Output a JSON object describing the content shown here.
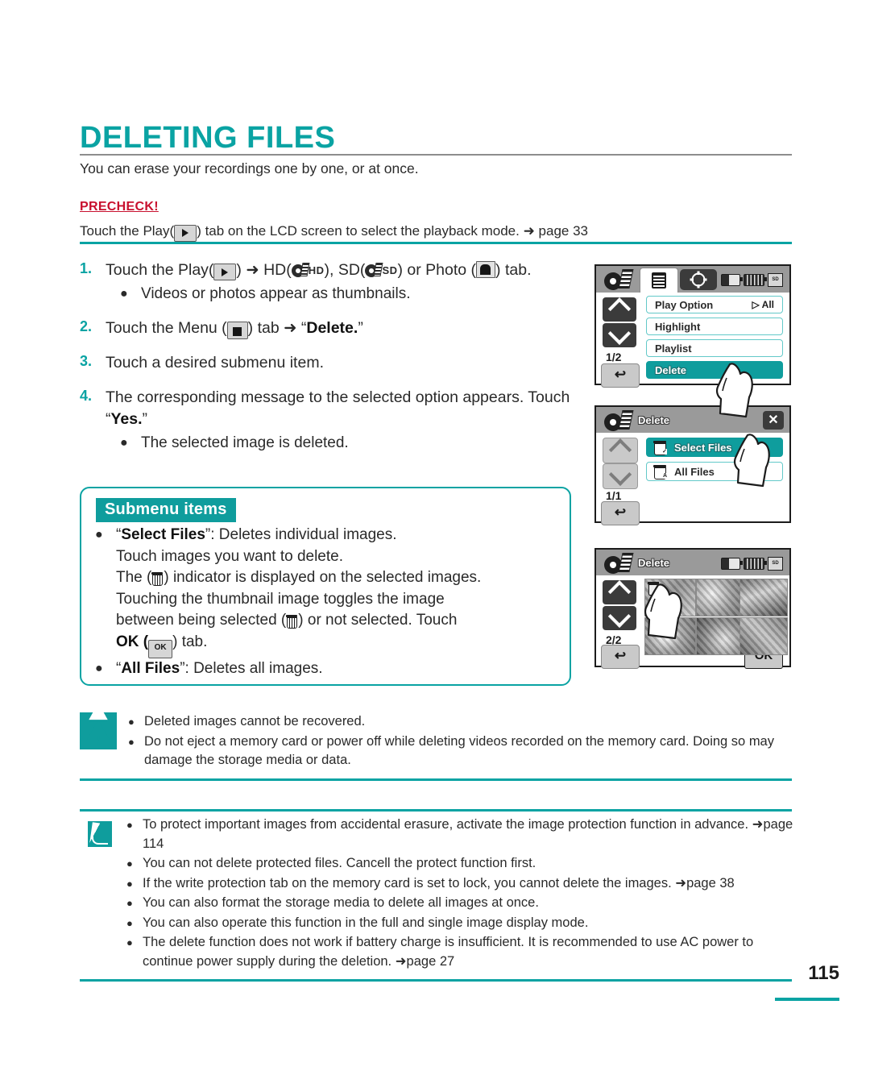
{
  "page": {
    "title": "DELETING FILES",
    "intro": "You can erase your recordings one by one, or at once.",
    "precheck_label": "PRECHECK!",
    "precheck_text_a": "Touch the Play(",
    "precheck_text_b": ") tab on the LCD screen to select the playback mode. ",
    "precheck_page_ref": "➜ page 33",
    "page_number": "115"
  },
  "steps": [
    {
      "num": "1.",
      "text_a": "Touch the Play(",
      "text_b": ") ➜ HD(",
      "hd_label": "HD",
      "text_c": "), SD(",
      "sd_label": "SD",
      "text_d": ") or Photo (",
      "text_e": ") tab.",
      "bullets": [
        "Videos or photos appear as thumbnails."
      ]
    },
    {
      "num": "2.",
      "text_a": "Touch the Menu (",
      "text_b": ") tab ➜ “",
      "bold": "Delete.",
      "text_c": "”",
      "bullets": []
    },
    {
      "num": "3.",
      "text_a": "Touch a desired submenu item.",
      "bullets": []
    },
    {
      "num": "4.",
      "text_a": "The corresponding message to the selected option appears. Touch “",
      "bold": "Yes.",
      "text_c": "”",
      "bullets": [
        "The selected image is deleted."
      ]
    }
  ],
  "submenu": {
    "title": "Submenu items",
    "items": [
      {
        "name": "Select Files",
        "quote_open": "“",
        "quote_close": "”",
        "line1_tail": ": Deletes individual images.",
        "line2": "Touch images you want to delete.",
        "line3_a": "The (",
        "line3_b": ") indicator is displayed on the selected images.",
        "line4": "Touching the thumbnail image toggles the image",
        "line5_a": "between being selected (",
        "line5_b": ") or not selected. Touch",
        "line6_a": "OK (",
        "line6_b": ") tab."
      },
      {
        "name": "All Files",
        "quote_open": "“",
        "quote_close": "”",
        "line1_tail": ": Deletes all images."
      }
    ]
  },
  "warning_notes": [
    "Deleted images cannot be recovered.",
    "Do not eject a memory card or power off while deleting videos recorded on the memory card. Doing so may damage the storage media or data."
  ],
  "info_notes": [
    "To protect important images from accidental erasure, activate the image protection function in advance. ➜page 114",
    "You can not delete protected files. Cancell the protect function first.",
    "If the write protection tab on the memory card is set to lock, you cannot delete the images. ➜page 38",
    "You can also format the storage media to delete all images at once.",
    "You can also operate this function in the full and single image display mode.",
    "The delete function does not work if battery charge is  insufficient. It is recommended to use AC power to continue power supply during the deletion. ➜page 27"
  ],
  "lcd_screens": [
    {
      "id": "menu-screen",
      "tabs": [
        "film-tab",
        "menu-tab",
        "gear-tab"
      ],
      "status_icons": [
        "battery-low-icon",
        "battery-full-icon",
        "memory-card-icon"
      ],
      "page_indicator": "1/2",
      "back_label": "↩",
      "rows": [
        {
          "label": "Play Option",
          "selected": false,
          "indicator": "▷ All"
        },
        {
          "label": "Highlight",
          "selected": false,
          "indicator": ""
        },
        {
          "label": "Playlist",
          "selected": false,
          "indicator": ""
        },
        {
          "label": "Delete",
          "selected": true,
          "indicator": ""
        }
      ]
    },
    {
      "id": "delete-submenu-screen",
      "title": "Delete",
      "close_label": "✕",
      "page_indicator": "1/1",
      "back_label": "↩",
      "rows": [
        {
          "label": "Select Files",
          "selected": true,
          "icon": "trash-check-icon"
        },
        {
          "label": "All Files",
          "selected": false,
          "icon": "trash-all-icon"
        }
      ]
    },
    {
      "id": "thumbnail-select-screen",
      "title": "Delete",
      "status_icons": [
        "battery-low-icon",
        "battery-full-icon",
        "memory-card-icon"
      ],
      "page_indicator": "2/2",
      "back_label": "↩",
      "ok_label": "OK",
      "thumbnails": [
        {
          "name": "bird-thumbnail",
          "selected": true
        },
        {
          "name": "flowers-thumbnail",
          "selected": false
        },
        {
          "name": "cactus-thumbnail",
          "selected": false
        },
        {
          "name": "dandelion-thumbnail",
          "selected": false
        },
        {
          "name": "puppy-thumbnail",
          "selected": false
        },
        {
          "name": "peppers-thumbnail",
          "selected": false
        }
      ]
    }
  ],
  "colors": {
    "accent_teal": "#0aa3a3",
    "title_teal": "#0aa3a3",
    "badge_teal": "#0f9d9d",
    "precheck_red": "#c8102e",
    "selected_row": "#0f9d9d"
  }
}
